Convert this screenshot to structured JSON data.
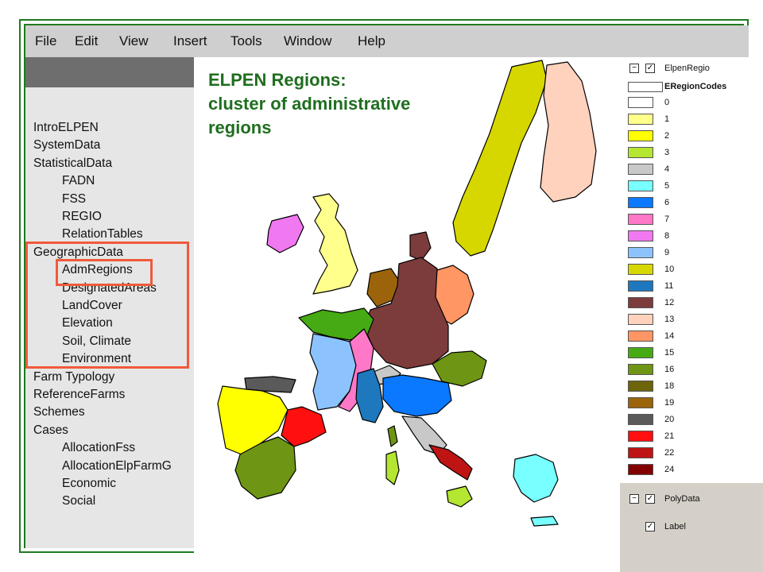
{
  "menu": [
    "File",
    "Edit",
    "View",
    "Insert",
    "Tools",
    "Window",
    "Help"
  ],
  "tree": [
    {
      "label": "IntroELPEN",
      "level": 1
    },
    {
      "label": "SystemData",
      "level": 1
    },
    {
      "label": "StatisticalData",
      "level": 1
    },
    {
      "label": "FADN",
      "level": 2
    },
    {
      "label": "FSS",
      "level": 2
    },
    {
      "label": "REGIO",
      "level": 2
    },
    {
      "label": "RelationTables",
      "level": 2
    },
    {
      "label": "GeographicData",
      "level": 1
    },
    {
      "label": "AdmRegions",
      "level": 2
    },
    {
      "label": "DesignatedAreas",
      "level": 2
    },
    {
      "label": "LandCover",
      "level": 2
    },
    {
      "label": "Elevation",
      "level": 2
    },
    {
      "label": "Soil, Climate",
      "level": 2
    },
    {
      "label": "Environment",
      "level": 2
    },
    {
      "label": "Farm Typology",
      "level": 1
    },
    {
      "label": "ReferenceFarms",
      "level": 1
    },
    {
      "label": "Schemes",
      "level": 1
    },
    {
      "label": "Cases",
      "level": 1
    },
    {
      "label": "AllocationFss",
      "level": 2
    },
    {
      "label": "AllocationElpFarmG",
      "level": 2
    },
    {
      "label": "Economic",
      "level": 2
    },
    {
      "label": "Social",
      "level": 2
    }
  ],
  "map": {
    "title_line1": "ELPEN Regions:",
    "title_line2": "cluster of administrative",
    "title_line3": "regions"
  },
  "legend": {
    "layer1": "ElpenRegio",
    "field": "ERegionCodes",
    "classes": [
      {
        "code": "0",
        "color": "#ffffff"
      },
      {
        "code": "1",
        "color": "#ffff8c"
      },
      {
        "code": "2",
        "color": "#ffff00"
      },
      {
        "code": "3",
        "color": "#b4e632"
      },
      {
        "code": "4",
        "color": "#c8c8c8"
      },
      {
        "code": "5",
        "color": "#78ffff"
      },
      {
        "code": "6",
        "color": "#0a78ff"
      },
      {
        "code": "7",
        "color": "#ff78c8"
      },
      {
        "code": "8",
        "color": "#f078f0"
      },
      {
        "code": "9",
        "color": "#8cc3ff"
      },
      {
        "code": "10",
        "color": "#d7d700"
      },
      {
        "code": "11",
        "color": "#1e78be"
      },
      {
        "code": "12",
        "color": "#7d3c3c"
      },
      {
        "code": "13",
        "color": "#ffd2be"
      },
      {
        "code": "14",
        "color": "#ff9664"
      },
      {
        "code": "15",
        "color": "#46aa14"
      },
      {
        "code": "16",
        "color": "#6e9614"
      },
      {
        "code": "18",
        "color": "#6e640a"
      },
      {
        "code": "19",
        "color": "#9b640a"
      },
      {
        "code": "20",
        "color": "#5a5a5a"
      },
      {
        "code": "21",
        "color": "#ff0f0f"
      },
      {
        "code": "22",
        "color": "#be1414"
      },
      {
        "code": "24",
        "color": "#820000"
      }
    ],
    "layer2": "PolyData",
    "layer3": "Label"
  }
}
